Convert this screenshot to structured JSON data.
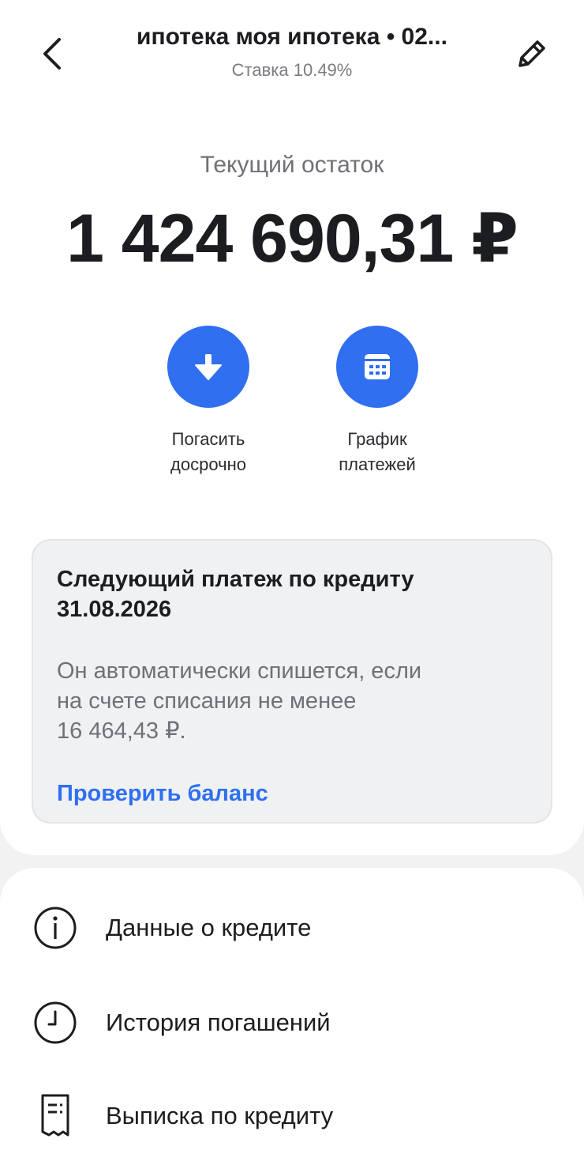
{
  "header": {
    "title": "ипотека моя ипотека • 02...",
    "subtitle": "Ставка 10.49%",
    "back_icon": "chevron-left-icon",
    "edit_icon": "pencil-icon"
  },
  "balance": {
    "label": "Текущий остаток",
    "value": "1 424 690,31 ₽"
  },
  "actions": [
    {
      "label_line1": "Погасить",
      "label_line2": "досрочно",
      "icon": "arrow-down-icon"
    },
    {
      "label_line1": "График",
      "label_line2": "платежей",
      "icon": "calendar-icon"
    }
  ],
  "next_payment": {
    "title_line1": "Следующий платеж по кредиту",
    "title_line2": "31.08.2026",
    "text_line1": "Он автоматически спишется, если",
    "text_line2": "на счете списания не менее",
    "text_line3": "16 464,43 ₽.",
    "link": "Проверить баланс"
  },
  "menu": [
    {
      "label": "Данные о кредите",
      "icon": "info-icon"
    },
    {
      "label": "История погашений",
      "icon": "clock-icon"
    },
    {
      "label": "Выписка по кредиту",
      "icon": "receipt-icon"
    }
  ],
  "colors": {
    "accent": "#2f6ff0",
    "text_primary": "#1c1d21",
    "text_secondary": "#6f7177",
    "background": "#f2f2f3"
  }
}
